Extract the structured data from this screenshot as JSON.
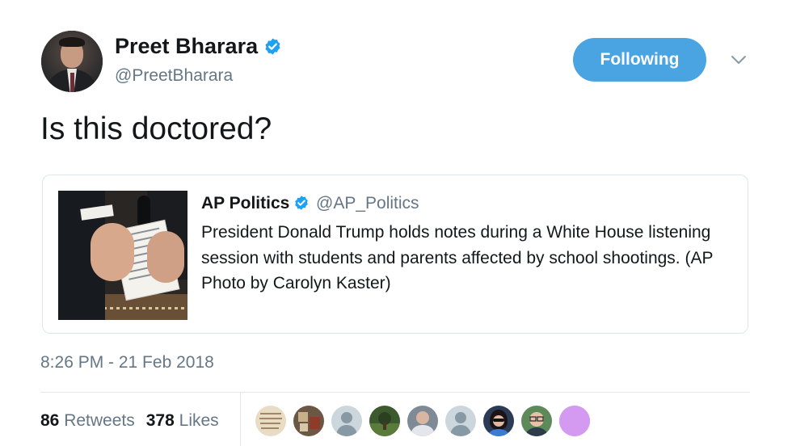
{
  "author": {
    "name": "Preet Bharara",
    "handle": "@PreetBharara",
    "verified_color": "#1da1f2"
  },
  "follow_button": {
    "label": "Following",
    "color": "#4aa4e2"
  },
  "menu_icon": "chevron-down-icon",
  "tweet": {
    "text": "Is this doctored?"
  },
  "quoted_tweet": {
    "name": "AP Politics",
    "handle": "@AP_Politics",
    "text": "President Donald Trump holds notes during a White House listening session with students and parents affected by school shootings. (AP Photo by Carolyn Kaster)"
  },
  "timestamp": "8:26 PM - 21 Feb 2018",
  "stats": {
    "retweets_count": "86",
    "retweets_label": "Retweets",
    "likes_count": "378",
    "likes_label": "Likes"
  },
  "likers": [
    {
      "icon": "avatar-handwriting"
    },
    {
      "icon": "avatar-photo"
    },
    {
      "icon": "default-avatar-icon"
    },
    {
      "icon": "avatar-landscape"
    },
    {
      "icon": "avatar-person"
    },
    {
      "icon": "default-avatar-icon"
    },
    {
      "icon": "avatar-person-sunglasses"
    },
    {
      "icon": "avatar-person-glasses"
    },
    {
      "icon": "avatar-purple",
      "color": "#d499f0"
    }
  ]
}
